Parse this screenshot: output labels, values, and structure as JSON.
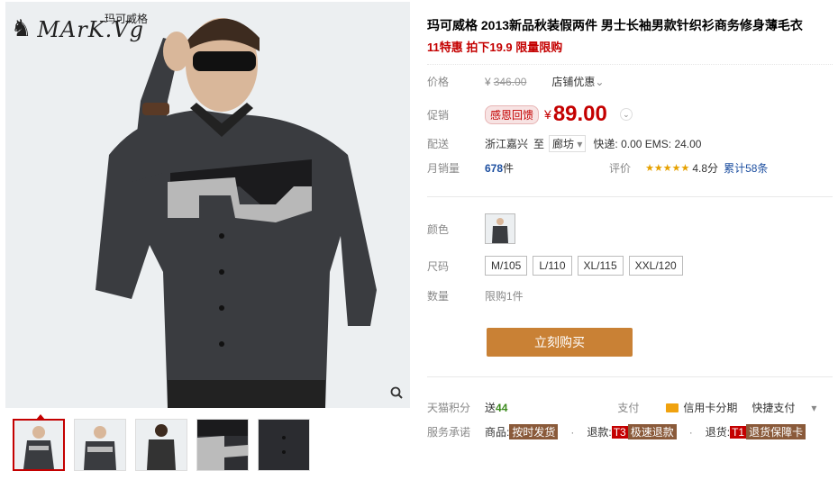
{
  "brand": {
    "logo": "MArK.Vg",
    "cn": "玛可威格"
  },
  "product": {
    "title": "玛可威格 2013新品秋装假两件 男士长袖男款针织衫商务修身薄毛衣",
    "subtitle": "11特惠 拍下19.9 限量限购"
  },
  "price": {
    "label": "价格",
    "original": "346.00",
    "currency": "¥",
    "discount_label": "店铺优惠",
    "promo_label": "促销",
    "promo_tag": "感恩回馈",
    "promo_price": "89.00"
  },
  "shipping": {
    "label": "配送",
    "from": "浙江嘉兴",
    "to_word": "至",
    "to": "廊坊",
    "fees": "快递: 0.00 EMS: 24.00"
  },
  "sales": {
    "label": "月销量",
    "count": "678",
    "unit": "件",
    "rating_label": "评价",
    "stars": "★★★★★",
    "score": "4.8分",
    "reviews": "累计58条"
  },
  "options": {
    "color_label": "颜色",
    "size_label": "尺码",
    "sizes": [
      "M/105",
      "L/110",
      "XL/115",
      "XXL/120"
    ],
    "qty_label": "数量",
    "qty_text": "限购1件"
  },
  "buy_button": "立刻购买",
  "tmall": {
    "points_label": "天猫积分",
    "points_prefix": "送",
    "points": "44",
    "pay_label": "支付",
    "credit": "信用卡分期",
    "quick": "快捷支付"
  },
  "service": {
    "label": "服务承诺",
    "goods_prefix": "商品:",
    "goods_tag": "按时发货",
    "refund_prefix": "退款:",
    "refund_code": "T3",
    "refund_tag": "极速退款",
    "return_prefix": "退货:",
    "return_code": "T1",
    "return_tag": "退货保障卡"
  },
  "colors": {
    "accent": "#c40000",
    "buy": "#c98135"
  }
}
